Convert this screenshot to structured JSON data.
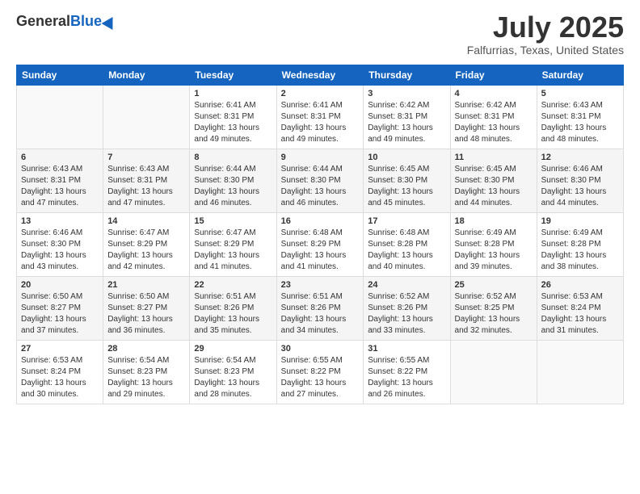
{
  "header": {
    "logo_general": "General",
    "logo_blue": "Blue",
    "month_title": "July 2025",
    "location": "Falfurrias, Texas, United States"
  },
  "days_of_week": [
    "Sunday",
    "Monday",
    "Tuesday",
    "Wednesday",
    "Thursday",
    "Friday",
    "Saturday"
  ],
  "weeks": [
    [
      {
        "day": "",
        "info": ""
      },
      {
        "day": "",
        "info": ""
      },
      {
        "day": "1",
        "sunrise": "6:41 AM",
        "sunset": "8:31 PM",
        "daylight": "13 hours and 49 minutes."
      },
      {
        "day": "2",
        "sunrise": "6:41 AM",
        "sunset": "8:31 PM",
        "daylight": "13 hours and 49 minutes."
      },
      {
        "day": "3",
        "sunrise": "6:42 AM",
        "sunset": "8:31 PM",
        "daylight": "13 hours and 49 minutes."
      },
      {
        "day": "4",
        "sunrise": "6:42 AM",
        "sunset": "8:31 PM",
        "daylight": "13 hours and 48 minutes."
      },
      {
        "day": "5",
        "sunrise": "6:43 AM",
        "sunset": "8:31 PM",
        "daylight": "13 hours and 48 minutes."
      }
    ],
    [
      {
        "day": "6",
        "sunrise": "6:43 AM",
        "sunset": "8:31 PM",
        "daylight": "13 hours and 47 minutes."
      },
      {
        "day": "7",
        "sunrise": "6:43 AM",
        "sunset": "8:31 PM",
        "daylight": "13 hours and 47 minutes."
      },
      {
        "day": "8",
        "sunrise": "6:44 AM",
        "sunset": "8:30 PM",
        "daylight": "13 hours and 46 minutes."
      },
      {
        "day": "9",
        "sunrise": "6:44 AM",
        "sunset": "8:30 PM",
        "daylight": "13 hours and 46 minutes."
      },
      {
        "day": "10",
        "sunrise": "6:45 AM",
        "sunset": "8:30 PM",
        "daylight": "13 hours and 45 minutes."
      },
      {
        "day": "11",
        "sunrise": "6:45 AM",
        "sunset": "8:30 PM",
        "daylight": "13 hours and 44 minutes."
      },
      {
        "day": "12",
        "sunrise": "6:46 AM",
        "sunset": "8:30 PM",
        "daylight": "13 hours and 44 minutes."
      }
    ],
    [
      {
        "day": "13",
        "sunrise": "6:46 AM",
        "sunset": "8:30 PM",
        "daylight": "13 hours and 43 minutes."
      },
      {
        "day": "14",
        "sunrise": "6:47 AM",
        "sunset": "8:29 PM",
        "daylight": "13 hours and 42 minutes."
      },
      {
        "day": "15",
        "sunrise": "6:47 AM",
        "sunset": "8:29 PM",
        "daylight": "13 hours and 41 minutes."
      },
      {
        "day": "16",
        "sunrise": "6:48 AM",
        "sunset": "8:29 PM",
        "daylight": "13 hours and 41 minutes."
      },
      {
        "day": "17",
        "sunrise": "6:48 AM",
        "sunset": "8:28 PM",
        "daylight": "13 hours and 40 minutes."
      },
      {
        "day": "18",
        "sunrise": "6:49 AM",
        "sunset": "8:28 PM",
        "daylight": "13 hours and 39 minutes."
      },
      {
        "day": "19",
        "sunrise": "6:49 AM",
        "sunset": "8:28 PM",
        "daylight": "13 hours and 38 minutes."
      }
    ],
    [
      {
        "day": "20",
        "sunrise": "6:50 AM",
        "sunset": "8:27 PM",
        "daylight": "13 hours and 37 minutes."
      },
      {
        "day": "21",
        "sunrise": "6:50 AM",
        "sunset": "8:27 PM",
        "daylight": "13 hours and 36 minutes."
      },
      {
        "day": "22",
        "sunrise": "6:51 AM",
        "sunset": "8:26 PM",
        "daylight": "13 hours and 35 minutes."
      },
      {
        "day": "23",
        "sunrise": "6:51 AM",
        "sunset": "8:26 PM",
        "daylight": "13 hours and 34 minutes."
      },
      {
        "day": "24",
        "sunrise": "6:52 AM",
        "sunset": "8:26 PM",
        "daylight": "13 hours and 33 minutes."
      },
      {
        "day": "25",
        "sunrise": "6:52 AM",
        "sunset": "8:25 PM",
        "daylight": "13 hours and 32 minutes."
      },
      {
        "day": "26",
        "sunrise": "6:53 AM",
        "sunset": "8:24 PM",
        "daylight": "13 hours and 31 minutes."
      }
    ],
    [
      {
        "day": "27",
        "sunrise": "6:53 AM",
        "sunset": "8:24 PM",
        "daylight": "13 hours and 30 minutes."
      },
      {
        "day": "28",
        "sunrise": "6:54 AM",
        "sunset": "8:23 PM",
        "daylight": "13 hours and 29 minutes."
      },
      {
        "day": "29",
        "sunrise": "6:54 AM",
        "sunset": "8:23 PM",
        "daylight": "13 hours and 28 minutes."
      },
      {
        "day": "30",
        "sunrise": "6:55 AM",
        "sunset": "8:22 PM",
        "daylight": "13 hours and 27 minutes."
      },
      {
        "day": "31",
        "sunrise": "6:55 AM",
        "sunset": "8:22 PM",
        "daylight": "13 hours and 26 minutes."
      },
      {
        "day": "",
        "info": ""
      },
      {
        "day": "",
        "info": ""
      }
    ]
  ],
  "labels": {
    "sunrise_prefix": "Sunrise: ",
    "sunset_prefix": "Sunset: ",
    "daylight_prefix": "Daylight: "
  }
}
